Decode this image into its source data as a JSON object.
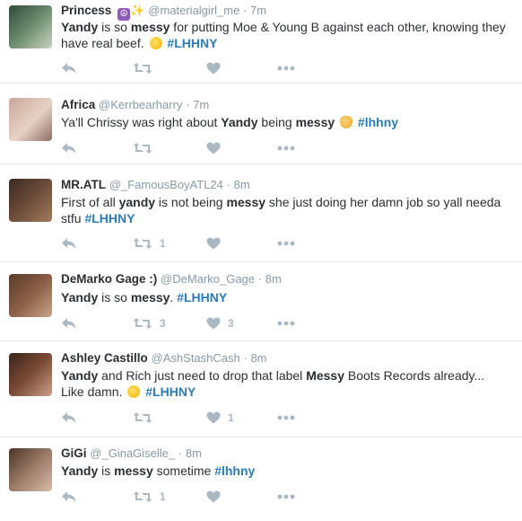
{
  "tweets": [
    {
      "name": "Princess",
      "handle": "@materialgirl_me",
      "time": "· 7m",
      "text_parts": [
        {
          "t": "Yandy",
          "s": "b"
        },
        {
          "t": " is so ",
          "s": "n"
        },
        {
          "t": "messy",
          "s": "b"
        },
        {
          "t": " for putting Moe & Young B against each other, knowing they have real beef. ",
          "s": "n"
        },
        {
          "t": "",
          "s": "emoji"
        },
        {
          "t": " #LHHNY",
          "s": "tag"
        }
      ],
      "retweets": "",
      "likes": ""
    },
    {
      "name": "Africa",
      "handle": "@Kerrbearharry",
      "time": "· 7m",
      "text_parts": [
        {
          "t": "Ya'll Chrissy was right about ",
          "s": "n"
        },
        {
          "t": "Yandy",
          "s": "b"
        },
        {
          "t": " being ",
          "s": "n"
        },
        {
          "t": "messy",
          "s": "b"
        },
        {
          "t": " ",
          "s": "n"
        },
        {
          "t": "",
          "s": "emoji"
        },
        {
          "t": " #lhhny",
          "s": "tag"
        }
      ],
      "retweets": "",
      "likes": ""
    },
    {
      "name": "MR.ATL",
      "handle": "@_FamousBoyATL24",
      "time": "· 8m",
      "text_parts": [
        {
          "t": "First of all ",
          "s": "n"
        },
        {
          "t": "yandy",
          "s": "b"
        },
        {
          "t": " is not being ",
          "s": "n"
        },
        {
          "t": "messy",
          "s": "b"
        },
        {
          "t": " she just doing her damn job so yall needa stfu ",
          "s": "n"
        },
        {
          "t": "#LHHNY",
          "s": "tag"
        }
      ],
      "retweets": "1",
      "likes": ""
    },
    {
      "name": "DeMarko Gage :)",
      "handle": "@DeMarko_Gage",
      "time": "· 8m",
      "text_parts": [
        {
          "t": "Yandy",
          "s": "b"
        },
        {
          "t": " is so ",
          "s": "n"
        },
        {
          "t": "messy",
          "s": "b"
        },
        {
          "t": ". ",
          "s": "n"
        },
        {
          "t": "#LHHNY",
          "s": "tag"
        }
      ],
      "retweets": "3",
      "likes": "3"
    },
    {
      "name": "Ashley Castillo",
      "handle": "@AshStashCash",
      "time": "· 8m",
      "text_parts": [
        {
          "t": "Yandy",
          "s": "b"
        },
        {
          "t": " and Rich just need to drop that label ",
          "s": "n"
        },
        {
          "t": "Messy",
          "s": "b"
        },
        {
          "t": " Boots Records already... Like damn. ",
          "s": "n"
        },
        {
          "t": "",
          "s": "emoji"
        },
        {
          "t": " #LHHNY",
          "s": "tag"
        }
      ],
      "retweets": "",
      "likes": "1"
    },
    {
      "name": "GiGi",
      "handle": "@_GinaGiselle_",
      "time": "· 8m",
      "text_parts": [
        {
          "t": "Yandy",
          "s": "b"
        },
        {
          "t": " is ",
          "s": "n"
        },
        {
          "t": "messy",
          "s": "b"
        },
        {
          "t": " sometime ",
          "s": "n"
        },
        {
          "t": "#lhhny",
          "s": "tag"
        }
      ],
      "retweets": "1",
      "likes": ""
    }
  ],
  "colors": {
    "name": "#292f33",
    "muted": "#8899a6",
    "hashtag": "#2b7bb9",
    "icon": "#aab8c2",
    "divider": "#e1e8ed"
  },
  "icons": {
    "reply": "reply-icon",
    "retweet": "retweet-icon",
    "like": "heart-icon",
    "more": "more-icon"
  }
}
